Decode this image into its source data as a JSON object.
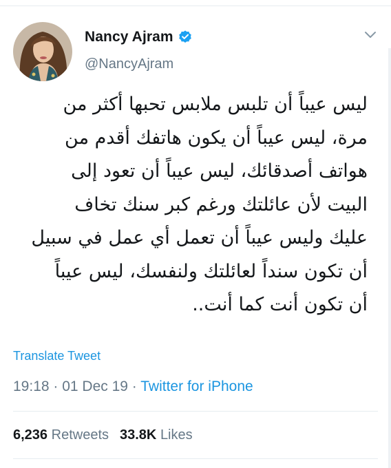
{
  "user": {
    "display_name": "Nancy Ajram",
    "handle": "@NancyAjram",
    "verified": true
  },
  "tweet": {
    "text": "ليس عيباً أن تلبس ملابس تحبها أكثر من\nمرة، ليس عيباً أن يكون هاتفك أقدم من\nهواتف أصدقائك، ليس عيباً أن تعود إلى\nالبيت لأن عائلتك ورغم كبر سنك تخاف\nعليك وليس عيباً أن تعمل أي عمل في سبيل\nأن تكون سنداً لعائلتك ولنفسك، ليس عيباً\nأن تكون أنت كما أنت..",
    "translate_label": "Translate Tweet",
    "time": "19:18",
    "date": "01 Dec 19",
    "separator": " · ",
    "source": "Twitter for iPhone"
  },
  "stats": {
    "retweets_count": "6,236",
    "retweets_label": "Retweets",
    "likes_count": "33.8K",
    "likes_label": "Likes"
  },
  "icons": {
    "verified": "verified-badge-icon",
    "menu": "chevron-down-icon"
  },
  "colors": {
    "link": "#1b95e0",
    "verified": "#1da1f2",
    "secondary_text": "#657786",
    "primary_text": "#14171a",
    "divider": "#e6ecf0"
  }
}
